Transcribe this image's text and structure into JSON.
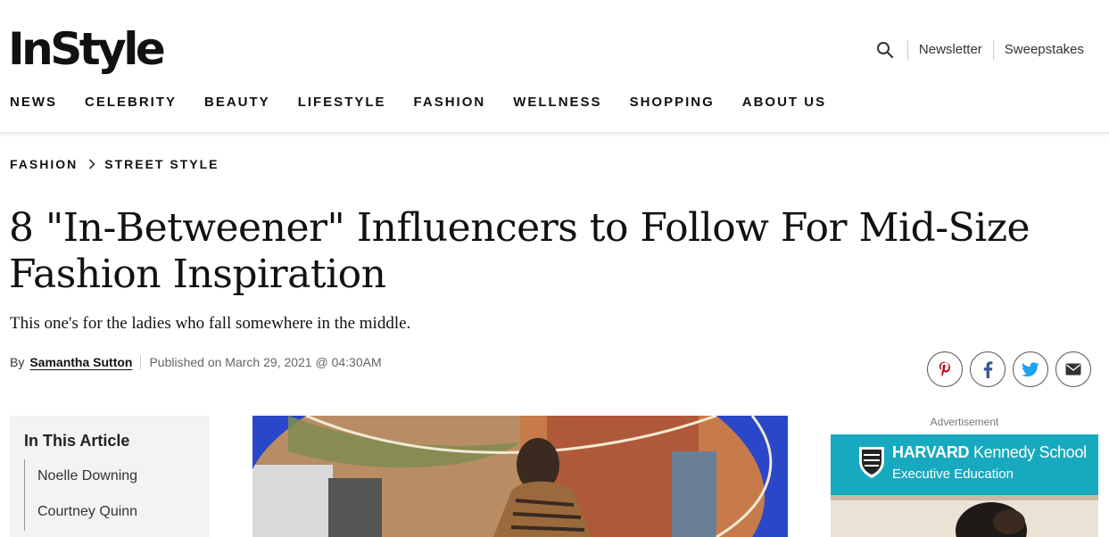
{
  "header": {
    "logo": "InStyle",
    "utility_links": [
      "Newsletter",
      "Sweepstakes"
    ],
    "nav": [
      "NEWS",
      "CELEBRITY",
      "BEAUTY",
      "LIFESTYLE",
      "FASHION",
      "WELLNESS",
      "SHOPPING",
      "ABOUT US"
    ]
  },
  "breadcrumb": [
    "FASHION",
    "STREET STYLE"
  ],
  "article": {
    "title": "8 \"In-Betweener\" Influencers to Follow For Mid-Size Fashion Inspiration",
    "dek": "This one's for the ladies who fall somewhere in the middle.",
    "by_label": "By",
    "author": "Samantha Sutton",
    "published": "Published on March 29, 2021 @ 04:30AM"
  },
  "share": [
    "pinterest-icon",
    "facebook-icon",
    "twitter-icon",
    "email-icon"
  ],
  "toc": {
    "title": "In This Article",
    "items": [
      "Noelle Downing",
      "Courtney Quinn"
    ]
  },
  "ad": {
    "label": "Advertisement",
    "brand_bold": "HARVARD",
    "brand_rest": "Kennedy School",
    "subline": "Executive Education"
  },
  "colors": {
    "pinterest": "#bd081c",
    "facebook": "#3b5998",
    "twitter": "#1da1f2",
    "ad_teal": "#17a9bf",
    "hero_blue": "#2b47c9"
  }
}
